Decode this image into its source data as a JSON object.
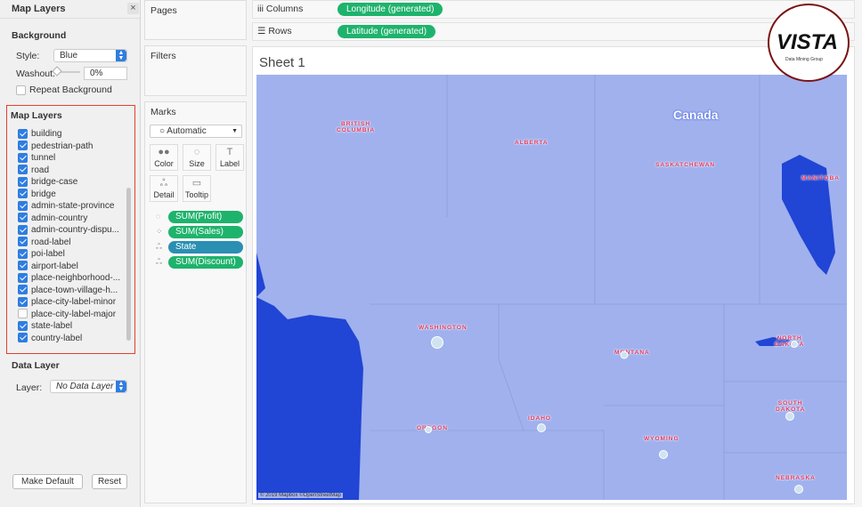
{
  "left_panel": {
    "title": "Map Layers",
    "close": "×",
    "background": {
      "heading": "Background",
      "style_label": "Style:",
      "style_value": "Blue",
      "washout_label": "Washout:",
      "washout_value": "0%",
      "washout_level": 0,
      "repeat_label": "Repeat Background",
      "repeat_checked": false
    },
    "map_layers": {
      "heading": "Map Layers",
      "items": [
        {
          "label": "building",
          "checked": true
        },
        {
          "label": "pedestrian-path",
          "checked": true
        },
        {
          "label": "tunnel",
          "checked": true
        },
        {
          "label": "road",
          "checked": true
        },
        {
          "label": "bridge-case",
          "checked": true
        },
        {
          "label": "bridge",
          "checked": true
        },
        {
          "label": "admin-state-province",
          "checked": true
        },
        {
          "label": "admin-country",
          "checked": true
        },
        {
          "label": "admin-country-dispu...",
          "checked": true
        },
        {
          "label": "road-label",
          "checked": true
        },
        {
          "label": "poi-label",
          "checked": true
        },
        {
          "label": "airport-label",
          "checked": true
        },
        {
          "label": "place-neighborhood-...",
          "checked": true
        },
        {
          "label": "place-town-village-h...",
          "checked": true
        },
        {
          "label": "place-city-label-minor",
          "checked": true
        },
        {
          "label": "place-city-label-major",
          "checked": false
        },
        {
          "label": "state-label",
          "checked": true
        },
        {
          "label": "country-label",
          "checked": true
        }
      ]
    },
    "data_layer": {
      "heading": "Data Layer",
      "layer_label": "Layer:",
      "layer_value": "No Data Layer"
    },
    "make_default": "Make Default",
    "reset": "Reset"
  },
  "pages": "Pages",
  "filters": "Filters",
  "marks": {
    "title": "Marks",
    "type": "Automatic",
    "buttons": [
      {
        "label": "Color",
        "icon": "color-dots"
      },
      {
        "label": "Size",
        "icon": "size-shapes"
      },
      {
        "label": "Label",
        "icon": "T"
      },
      {
        "label": "Detail",
        "icon": "detail-dots"
      },
      {
        "label": "Tooltip",
        "icon": "speech-bubble"
      }
    ],
    "pills": [
      {
        "label": "SUM(Profit)",
        "icon": "size-icon",
        "color": "#1eb36c"
      },
      {
        "label": "SUM(Sales)",
        "icon": "color-icon",
        "color": "#1eb36c"
      },
      {
        "label": "State",
        "icon": "detail-icon",
        "color": "#2a8fb3"
      },
      {
        "label": "SUM(Discount)",
        "icon": "detail-icon",
        "color": "#1eb36c"
      }
    ]
  },
  "columns": {
    "label": "Columns",
    "pill": "Longitude (generated)"
  },
  "rows": {
    "label": "Rows",
    "pill": "Latitude (generated)"
  },
  "sheet": {
    "title": "Sheet 1",
    "map": {
      "country": "Canada",
      "attribution": "© 2019 Mapbox ©OpenStreetMap",
      "labels": [
        "BRITISH\nCOLUMBIA",
        "ALBERTA",
        "SASKATCHEWAN",
        "MANITOBA",
        "WASHINGTON",
        "MONTANA",
        "NORTH\nDAKOTA",
        "IDAHO",
        "OREGON",
        "WYOMING",
        "SOUTH\nDAKOTA",
        "NEBRASKA"
      ],
      "water_color": "#2145d4",
      "land_color": "#a0b1ee"
    }
  },
  "logo": {
    "text": "VISTA",
    "sub": "Data Mining Group"
  }
}
